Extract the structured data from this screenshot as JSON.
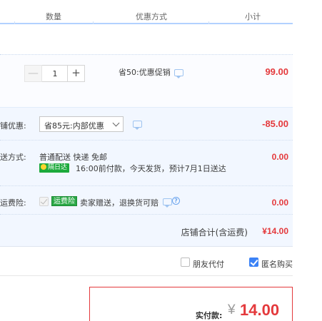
{
  "header": {
    "col_qty": "数量",
    "col_discount": "优惠方式",
    "col_subtotal": "小计"
  },
  "item": {
    "quantity": "1",
    "promo_text": "省50:优惠促销",
    "subtotal": "99.00"
  },
  "store": {
    "discount_label": "铺优惠:",
    "discount_selected": "省85元:内部优惠",
    "discount_amount": "-85.00",
    "shipping_label": "送方式:",
    "shipping_method": "普通配送 快递 免邮",
    "next_day_badge": "隔日达",
    "delivery_note": "16:00前付款，今天发货，预计7月1日送达",
    "shipping_fee": "0.00",
    "insurance_label": "运费险:",
    "insurance_badge": "运费险",
    "insurance_text": "卖家赠送，退换货可赔",
    "insurance_fee": "0.00",
    "total_label": "店铺合计(含运费)",
    "total": "¥14.00"
  },
  "options": {
    "friend_pay_label": "朋友代付",
    "friend_pay_checked": false,
    "anonymous_label": "匿名购买",
    "anonymous_checked": true
  },
  "payment": {
    "label": "实付款:",
    "currency": "¥",
    "amount": "14.00"
  },
  "colors": {
    "price_red": "#e4393c",
    "accent_blue": "#3b82f6",
    "badge_green": "#1caa3c",
    "section_bg": "#f2f7ff"
  },
  "icons": [
    "minus-icon",
    "plus-icon",
    "chat-icon",
    "chevron-down-icon",
    "help-icon",
    "checkbox-icon",
    "clock-icon"
  ]
}
